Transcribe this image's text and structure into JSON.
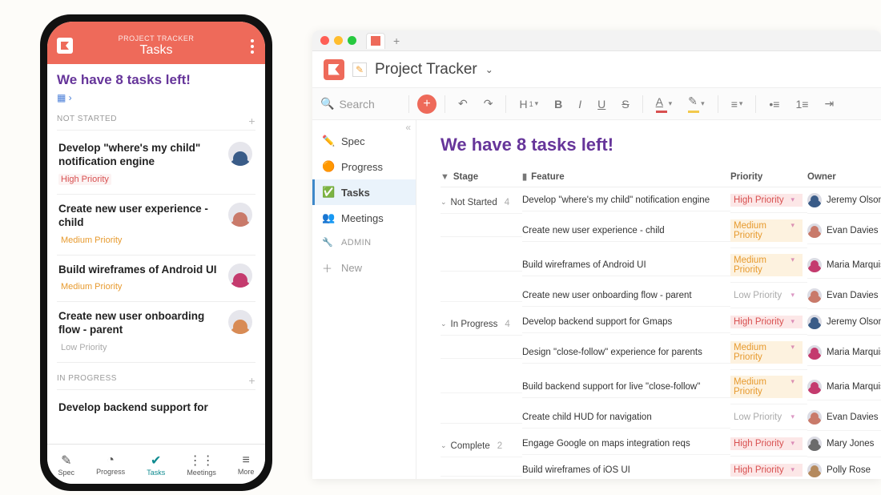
{
  "phone": {
    "subtitle": "PROJECT TRACKER",
    "title": "Tasks",
    "headline": "We have 8 tasks left!",
    "sections": {
      "not_started": {
        "label": "NOT STARTED"
      },
      "in_progress": {
        "label": "IN PROGRESS"
      }
    },
    "cards": [
      {
        "feature": "Develop \"where's my child\" notification engine",
        "priority": "High Priority",
        "priority_level": "high"
      },
      {
        "feature": "Create new user experience - child",
        "priority": "Medium Priority",
        "priority_level": "med"
      },
      {
        "feature": "Build wireframes of Android UI",
        "priority": "Medium Priority",
        "priority_level": "med"
      },
      {
        "feature": "Create new user onboarding flow - parent",
        "priority": "Low Priority",
        "priority_level": "low"
      }
    ],
    "inprog_first": "Develop backend support for",
    "tabs": {
      "spec": "Spec",
      "progress": "Progress",
      "tasks": "Tasks",
      "meetings": "Meetings",
      "more": "More"
    }
  },
  "desktop": {
    "doc_title": "Project Tracker",
    "search_placeholder": "Search",
    "sidebar": {
      "spec": "Spec",
      "progress": "Progress",
      "tasks": "Tasks",
      "meetings": "Meetings",
      "admin": "ADMIN",
      "new": "New"
    },
    "headline": "We have 8 tasks left!",
    "columns": {
      "stage": "Stage",
      "feature": "Feature",
      "priority": "Priority",
      "owner": "Owner"
    },
    "stages": {
      "not_started": {
        "label": "Not Started",
        "count": "4"
      },
      "in_progress": {
        "label": "In Progress",
        "count": "4"
      },
      "complete": {
        "label": "Complete",
        "count": "2"
      }
    },
    "rows": [
      {
        "stage": "not_started",
        "feature": "Develop \"where's my child\" notification engine",
        "priority": "High Priority",
        "plv": "high",
        "owner": "Jeremy Olson"
      },
      {
        "stage": "not_started",
        "feature": "Create new user experience - child",
        "priority": "Medium Priority",
        "plv": "med",
        "owner": "Evan Davies"
      },
      {
        "stage": "not_started",
        "feature": "Build wireframes of Android UI",
        "priority": "Medium Priority",
        "plv": "med",
        "owner": "Maria Marquis"
      },
      {
        "stage": "not_started",
        "feature": "Create new user onboarding flow - parent",
        "priority": "Low Priority",
        "plv": "low",
        "owner": "Evan Davies"
      },
      {
        "stage": "in_progress",
        "feature": "Develop backend support for Gmaps",
        "priority": "High Priority",
        "plv": "high",
        "owner": "Jeremy Olson"
      },
      {
        "stage": "in_progress",
        "feature": "Design \"close-follow\" experience for parents",
        "priority": "Medium Priority",
        "plv": "med",
        "owner": "Maria Marquis"
      },
      {
        "stage": "in_progress",
        "feature": "Build backend support for live \"close-follow\"",
        "priority": "Medium Priority",
        "plv": "med",
        "owner": "Maria Marquis"
      },
      {
        "stage": "in_progress",
        "feature": "Create child HUD for navigation",
        "priority": "Low Priority",
        "plv": "low",
        "owner": "Evan Davies"
      },
      {
        "stage": "complete",
        "feature": "Engage Google on maps integration reqs",
        "priority": "High Priority",
        "plv": "high",
        "owner": "Mary Jones"
      },
      {
        "stage": "complete",
        "feature": "Build wireframes of iOS UI",
        "priority": "High Priority",
        "plv": "high",
        "owner": "Polly Rose"
      }
    ]
  }
}
